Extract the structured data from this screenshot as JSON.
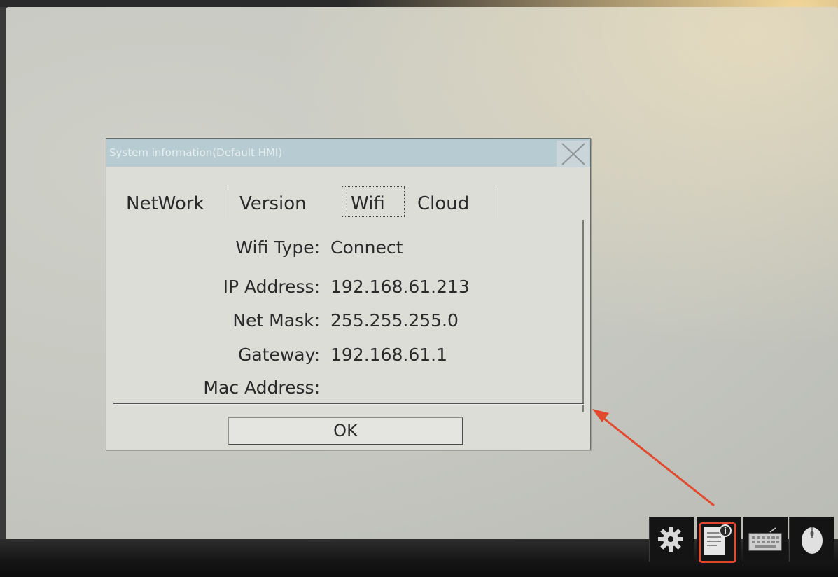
{
  "dialog": {
    "title": "System information(Default HMI)",
    "tabs": [
      {
        "label": "NetWork",
        "active": false
      },
      {
        "label": "Version",
        "active": false
      },
      {
        "label": "Wifi",
        "active": true
      },
      {
        "label": "Cloud",
        "active": false
      }
    ],
    "fields": [
      {
        "label": "Wifi Type:",
        "value": "Connect"
      },
      {
        "label": "IP Address:",
        "value": "192.168.61.213"
      },
      {
        "label": "Net Mask:",
        "value": "255.255.255.0"
      },
      {
        "label": "Gateway:",
        "value": "192.168.61.1"
      },
      {
        "label": "Mac Address:",
        "value": ""
      }
    ],
    "ok_label": "OK"
  },
  "taskbar": {
    "icons": [
      "gear-icon",
      "system-info-icon",
      "keyboard-icon",
      "mouse-icon"
    ],
    "highlighted": "system-info-icon"
  },
  "annotation": {
    "color": "#e24a30"
  }
}
